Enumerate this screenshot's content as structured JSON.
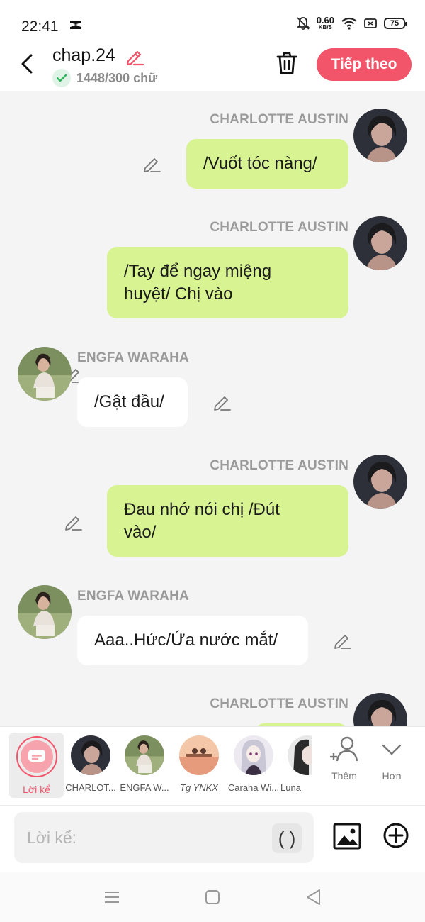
{
  "status_bar": {
    "time": "22:41",
    "net_speed": "0.60",
    "net_unit": "KB/S",
    "battery": "75"
  },
  "header": {
    "title": "chap.24",
    "word_count": "1448/300 chữ",
    "next_label": "Tiếp theo"
  },
  "messages": [
    {
      "side": "right",
      "name": "CHARLOTTE AUSTIN",
      "lines": [
        "/Vuốt tóc nàng/"
      ]
    },
    {
      "side": "right",
      "name": "CHARLOTTE AUSTIN",
      "lines": [
        "/Tay để ngay miệng",
        "huyệt/ Chị vào"
      ]
    },
    {
      "side": "left",
      "name": "ENGFA WARAHA",
      "lines": [
        "/Gật đầu/"
      ]
    },
    {
      "side": "right",
      "name": "CHARLOTTE AUSTIN",
      "lines": [
        "Đau nhớ nói chị /Đút",
        "vào/"
      ]
    },
    {
      "side": "left",
      "name": "ENGFA WARAHA",
      "lines": [
        "Aaa..Hức/Ứa nước mắt/"
      ]
    },
    {
      "side": "right",
      "name": "CHARLOTTE AUSTIN",
      "lines": [
        ""
      ]
    }
  ],
  "characters": {
    "narrator_label": "Lời kể",
    "items": [
      {
        "label": "CHARLOT..."
      },
      {
        "label": "ENGFA W..."
      },
      {
        "label": "Tg YNKX"
      },
      {
        "label": "Caraha Wi..."
      },
      {
        "label": "Luna"
      }
    ],
    "add_label": "Thêm",
    "more_label": "Hơn"
  },
  "composer": {
    "placeholder": "Lời kể:",
    "paren_label": "( )"
  },
  "colors": {
    "accent": "#f2546a",
    "bubble_right": "#d8f392",
    "bubble_left": "#ffffff"
  }
}
